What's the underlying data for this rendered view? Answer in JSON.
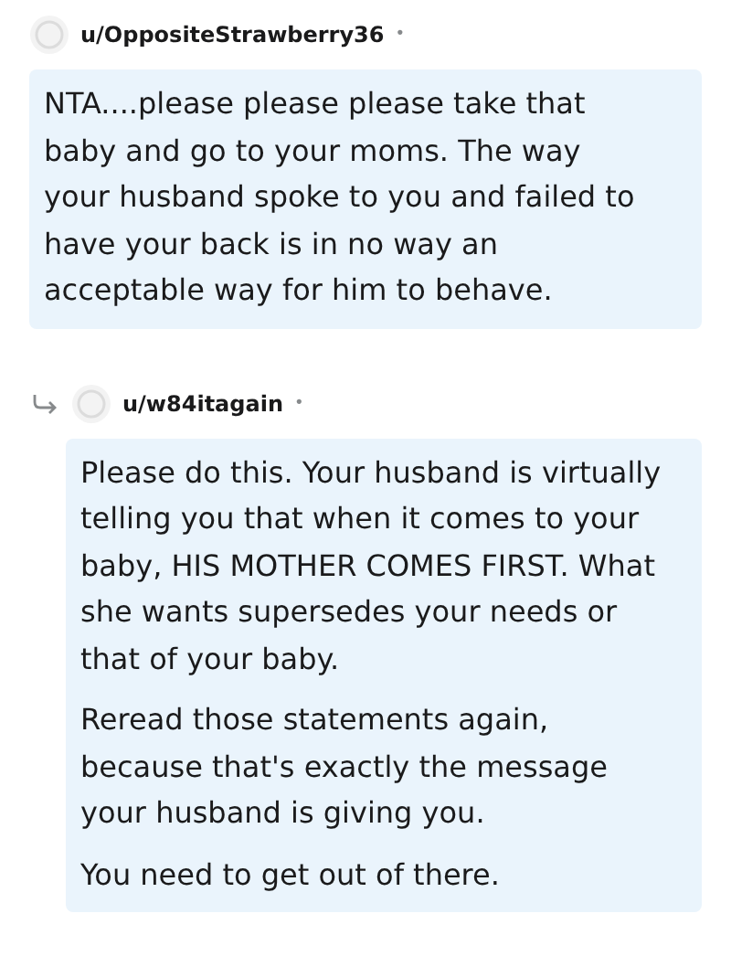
{
  "comments": [
    {
      "username": "u/OppositeStrawberry36",
      "separator": "•",
      "reply": false,
      "paragraphs": [
        "NTA....please please please take that baby and go to your moms. The way your husband spoke to you and failed to have your back is in no way an acceptable way for him to behave."
      ]
    },
    {
      "username": "u/w84itagain",
      "separator": "•",
      "reply": true,
      "paragraphs": [
        "Please do this. Your husband is virtually telling you that when it comes to your baby, HIS MOTHER COMES FIRST. What she wants supersedes your needs or that of your baby.",
        "Reread those statements again, because that's exactly the message your husband is giving you.",
        "You need to get out of there."
      ]
    }
  ]
}
